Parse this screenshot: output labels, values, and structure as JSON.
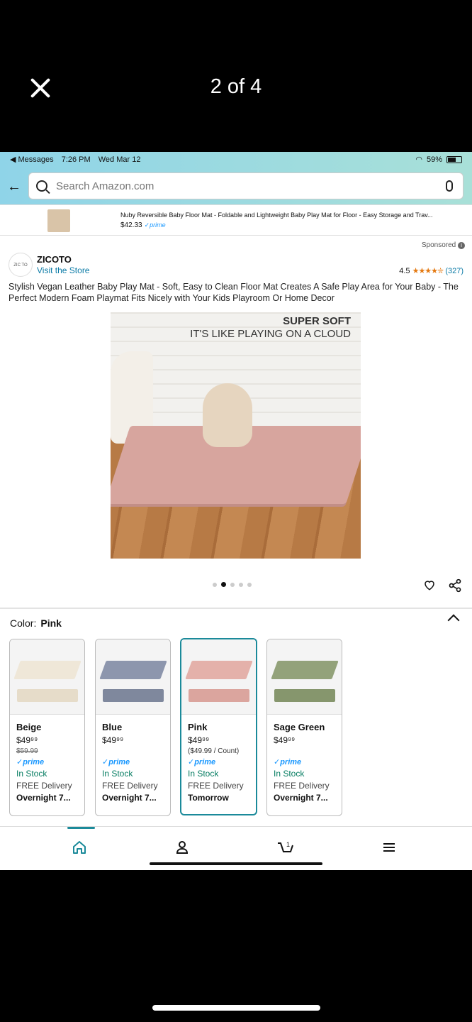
{
  "viewer": {
    "counter": "2 of 4"
  },
  "status": {
    "back_app": "◀ Messages",
    "time": "7:26 PM",
    "date": "Wed Mar 12",
    "battery": "59%"
  },
  "search": {
    "placeholder": "Search Amazon.com"
  },
  "sponsored_strip": {
    "title": "Nuby Reversible Baby Floor Mat - Foldable and Lightweight Baby Play Mat for Floor - Easy Storage and Trav...",
    "price": "$42.33",
    "prime": "✓prime"
  },
  "sponsored_tag": "Sponsored",
  "brand": {
    "logo_text": "ZIC TO",
    "name": "ZICOTO",
    "visit": "Visit the Store"
  },
  "rating": {
    "score": "4.5",
    "stars": "★★★★✮",
    "count": "(327)"
  },
  "product_title": "Stylish Vegan Leather Baby Play Mat - Soft, Easy to Clean Floor Mat Creates A Safe Play Area for Your Baby - The Perfect Modern Foam Playmat Fits Nicely with Your Kids Playroom Or Home Decor",
  "hero": {
    "headline": "SUPER SOFT",
    "subline": "IT'S LIKE PLAYING ON A CLOUD"
  },
  "color_selector": {
    "label": "Color:",
    "selected": "Pink"
  },
  "swatches": [
    {
      "name": "Beige",
      "price": "$49⁹⁹",
      "was": "$59.99",
      "unit": "",
      "prime": "✓prime",
      "stock": "In Stock",
      "delivery": "FREE Delivery",
      "eta": "Overnight 7...",
      "mat_color": "#efe7d8",
      "fold_color": "#e6dcc9"
    },
    {
      "name": "Blue",
      "price": "$49⁹⁹",
      "was": "",
      "unit": "",
      "prime": "✓prime",
      "stock": "In Stock",
      "delivery": "FREE Delivery",
      "eta": "Overnight 7...",
      "mat_color": "#8d96ad",
      "fold_color": "#7f889d"
    },
    {
      "name": "Pink",
      "price": "$49⁹⁹",
      "was": "",
      "unit": "($49.99 / Count)",
      "prime": "✓prime",
      "stock": "In Stock",
      "delivery": "FREE Delivery",
      "eta": "Tomorrow",
      "mat_color": "#e4b1aa",
      "fold_color": "#dba59e"
    },
    {
      "name": "Sage Green",
      "price": "$49⁹⁹",
      "was": "",
      "unit": "",
      "prime": "✓prime",
      "stock": "In Stock",
      "delivery": "FREE Delivery",
      "eta": "Overnight 7...",
      "mat_color": "#93a27a",
      "fold_color": "#86966d"
    }
  ],
  "carousel": {
    "total": 5,
    "active_index": 1
  }
}
